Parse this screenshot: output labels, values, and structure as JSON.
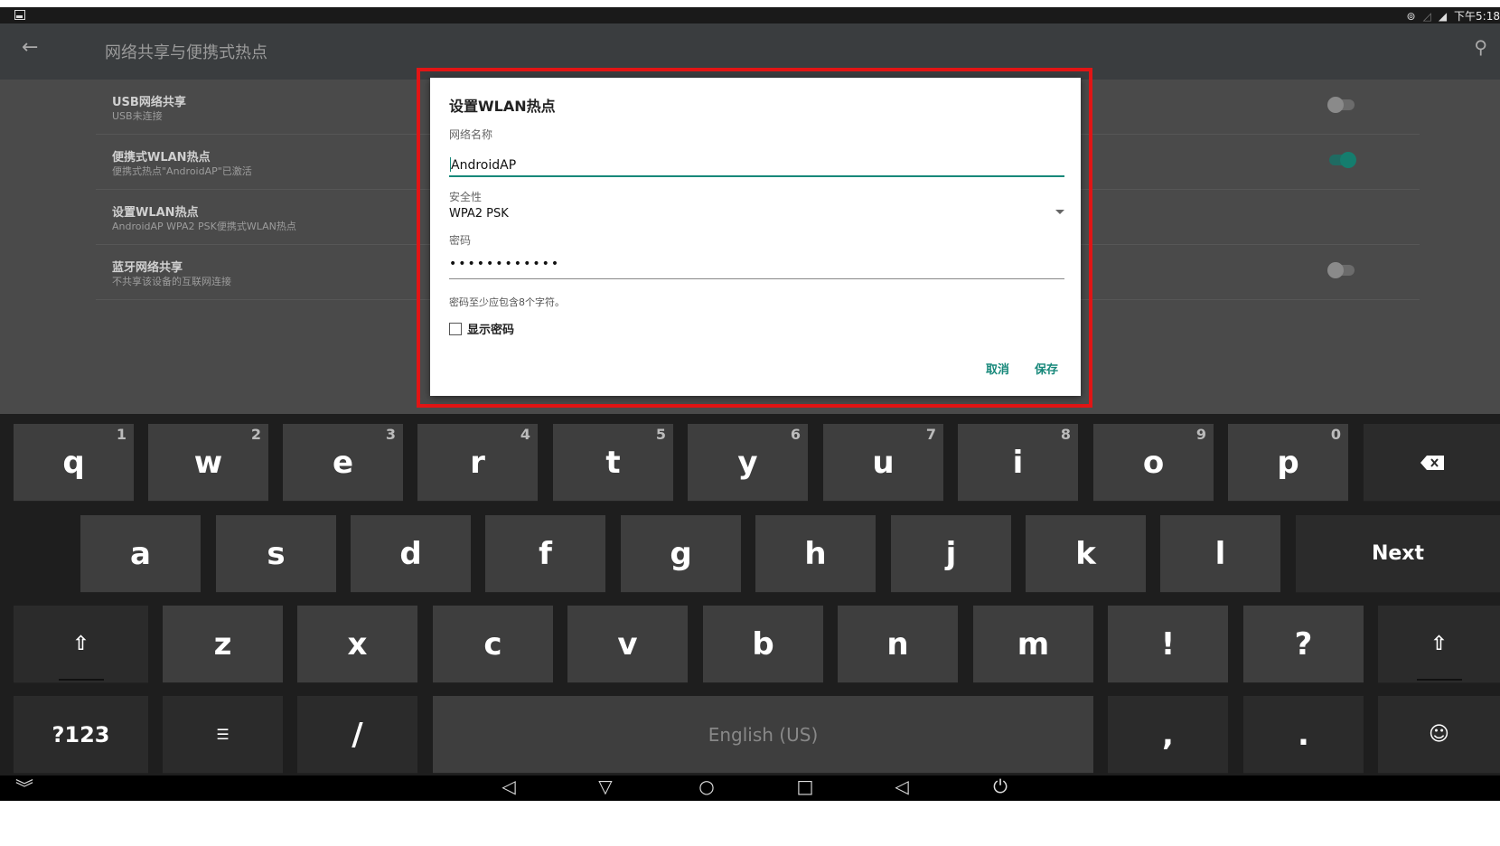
{
  "status_bar": {
    "time": "下午5:18"
  },
  "app_bar": {
    "title": "网络共享与便携式热点"
  },
  "settings": [
    {
      "title": "USB网络共享",
      "subtitle": "USB未连接",
      "toggle": "off"
    },
    {
      "title": "便携式WLAN热点",
      "subtitle": "便携式热点\"AndroidAP\"已激活",
      "toggle": "on"
    },
    {
      "title": "设置WLAN热点",
      "subtitle": "AndroidAP WPA2 PSK便携式WLAN热点",
      "toggle": null
    },
    {
      "title": "蓝牙网络共享",
      "subtitle": "不共享该设备的互联网连接",
      "toggle": "off"
    }
  ],
  "dialog": {
    "title": "设置WLAN热点",
    "ssid_label": "网络名称",
    "ssid_value": "AndroidAP",
    "security_label": "安全性",
    "security_value": "WPA2 PSK",
    "password_label": "密码",
    "password_value": "••••••••••••",
    "password_hint": "密码至少应包含8个字符。",
    "show_password_label": "显示密码",
    "cancel_label": "取消",
    "save_label": "保存"
  },
  "keyboard": {
    "row1": [
      {
        "k": "q",
        "n": "1"
      },
      {
        "k": "w",
        "n": "2"
      },
      {
        "k": "e",
        "n": "3"
      },
      {
        "k": "r",
        "n": "4"
      },
      {
        "k": "t",
        "n": "5"
      },
      {
        "k": "y",
        "n": "6"
      },
      {
        "k": "u",
        "n": "7"
      },
      {
        "k": "i",
        "n": "8"
      },
      {
        "k": "o",
        "n": "9"
      },
      {
        "k": "p",
        "n": "0"
      }
    ],
    "row2": [
      "a",
      "s",
      "d",
      "f",
      "g",
      "h",
      "j",
      "k",
      "l"
    ],
    "next_label": "Next",
    "row3": [
      "z",
      "x",
      "c",
      "v",
      "b",
      "n",
      "m",
      "!",
      "?"
    ],
    "symbols_label": "?123",
    "slash_label": "/",
    "space_label": "English (US)",
    "comma_label": ",",
    "period_label": ".",
    "colors": {
      "key": "#3e3e3e",
      "dark_key": "#2b2b2b",
      "accent": "#17887a",
      "highlight": "#e21515"
    }
  }
}
